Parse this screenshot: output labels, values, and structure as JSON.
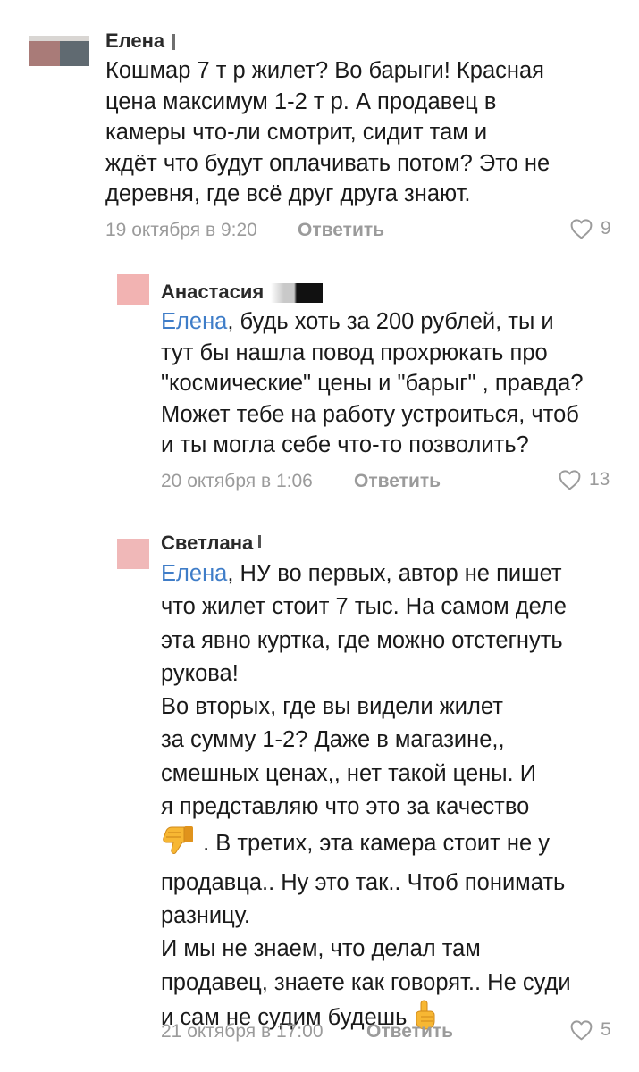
{
  "comments": [
    {
      "author": "Елена",
      "text": "Кошмар 7 т р жилет? Во барыги! Красная\nцена максимум 1-2 т р. А продавец в\nкамеры что-ли смотрит, сидит там и\nждёт что будут оплачивать потом? Это не\nдеревня, где всё друг друга знают.",
      "date": "19 октября в 9:20",
      "reply_label": "Ответить",
      "likes": "9"
    },
    {
      "author": "Анастасия",
      "mention": "Елена",
      "text": ", будь хоть за 200 рублей, ты и\nтут бы нашла повод прохрюкать про\n\"космические\" цены и \"барыг\" , правда?\nМожет тебе на работу устроиться, чтоб\nи ты могла себе что-то позволить?",
      "date": "20 октября в 1:06",
      "reply_label": "Ответить",
      "likes": "13"
    },
    {
      "author": "Светлана",
      "mention": "Елена",
      "text_part1": ", НУ во первых, автор не пишет\nчто жилет стоит 7 тыс. На самом деле\nэта явно  куртка, где можно отстегнуть\nрукова!\nВо вторых, где вы видели жилет\nза сумму 1-2? Даже в  магазине,,\nсмешных ценах,, нет такой цены. И\nя представляю что это за качество\n",
      "text_part2": " . В третих, эта камера стоит не у\nпродавца.. Ну это так.. Чтоб понимать\nразницу.\nИ мы не знаем, что делал там\nпродавец, знаете как говорят.. Не суди\nи сам не судим будешь",
      "emoji_1": "thumbs-down-emoji",
      "emoji_2": "index-pointing-up-emoji",
      "date": "21 октября в 17:00",
      "reply_label": "Ответить",
      "likes": "5"
    }
  ],
  "colors": {
    "mention": "#3f7dc8",
    "meta": "#9b9b9b",
    "text": "#1a1a1a"
  }
}
